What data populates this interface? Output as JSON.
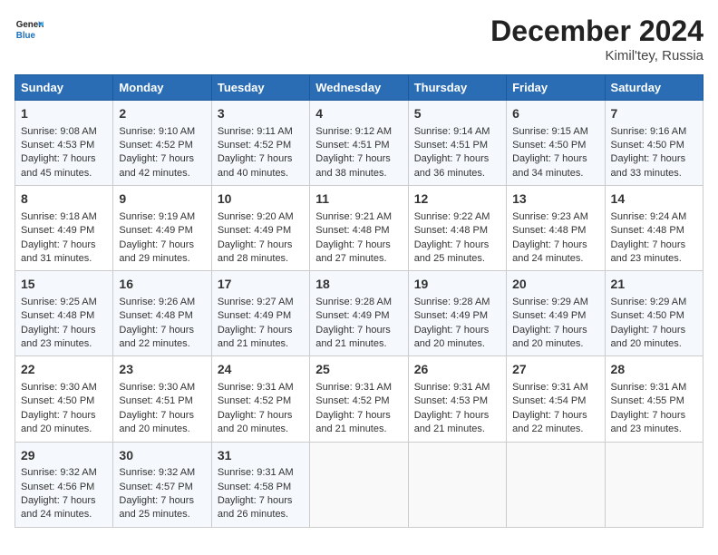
{
  "header": {
    "logo_line1": "General",
    "logo_line2": "Blue",
    "title": "December 2024",
    "subtitle": "Kimil'tey, Russia"
  },
  "weekdays": [
    "Sunday",
    "Monday",
    "Tuesday",
    "Wednesday",
    "Thursday",
    "Friday",
    "Saturday"
  ],
  "weeks": [
    [
      {
        "day": "1",
        "sun": "9:08 AM",
        "set": "4:53 PM",
        "hours": "7 hours and 45 minutes."
      },
      {
        "day": "2",
        "sun": "9:10 AM",
        "set": "4:52 PM",
        "hours": "7 hours and 42 minutes."
      },
      {
        "day": "3",
        "sun": "9:11 AM",
        "set": "4:52 PM",
        "hours": "7 hours and 40 minutes."
      },
      {
        "day": "4",
        "sun": "9:12 AM",
        "set": "4:51 PM",
        "hours": "7 hours and 38 minutes."
      },
      {
        "day": "5",
        "sun": "9:14 AM",
        "set": "4:51 PM",
        "hours": "7 hours and 36 minutes."
      },
      {
        "day": "6",
        "sun": "9:15 AM",
        "set": "4:50 PM",
        "hours": "7 hours and 34 minutes."
      },
      {
        "day": "7",
        "sun": "9:16 AM",
        "set": "4:50 PM",
        "hours": "7 hours and 33 minutes."
      }
    ],
    [
      {
        "day": "8",
        "sun": "9:18 AM",
        "set": "4:49 PM",
        "hours": "7 hours and 31 minutes."
      },
      {
        "day": "9",
        "sun": "9:19 AM",
        "set": "4:49 PM",
        "hours": "7 hours and 29 minutes."
      },
      {
        "day": "10",
        "sun": "9:20 AM",
        "set": "4:49 PM",
        "hours": "7 hours and 28 minutes."
      },
      {
        "day": "11",
        "sun": "9:21 AM",
        "set": "4:48 PM",
        "hours": "7 hours and 27 minutes."
      },
      {
        "day": "12",
        "sun": "9:22 AM",
        "set": "4:48 PM",
        "hours": "7 hours and 25 minutes."
      },
      {
        "day": "13",
        "sun": "9:23 AM",
        "set": "4:48 PM",
        "hours": "7 hours and 24 minutes."
      },
      {
        "day": "14",
        "sun": "9:24 AM",
        "set": "4:48 PM",
        "hours": "7 hours and 23 minutes."
      }
    ],
    [
      {
        "day": "15",
        "sun": "9:25 AM",
        "set": "4:48 PM",
        "hours": "7 hours and 23 minutes."
      },
      {
        "day": "16",
        "sun": "9:26 AM",
        "set": "4:48 PM",
        "hours": "7 hours and 22 minutes."
      },
      {
        "day": "17",
        "sun": "9:27 AM",
        "set": "4:49 PM",
        "hours": "7 hours and 21 minutes."
      },
      {
        "day": "18",
        "sun": "9:28 AM",
        "set": "4:49 PM",
        "hours": "7 hours and 21 minutes."
      },
      {
        "day": "19",
        "sun": "9:28 AM",
        "set": "4:49 PM",
        "hours": "7 hours and 20 minutes."
      },
      {
        "day": "20",
        "sun": "9:29 AM",
        "set": "4:49 PM",
        "hours": "7 hours and 20 minutes."
      },
      {
        "day": "21",
        "sun": "9:29 AM",
        "set": "4:50 PM",
        "hours": "7 hours and 20 minutes."
      }
    ],
    [
      {
        "day": "22",
        "sun": "9:30 AM",
        "set": "4:50 PM",
        "hours": "7 hours and 20 minutes."
      },
      {
        "day": "23",
        "sun": "9:30 AM",
        "set": "4:51 PM",
        "hours": "7 hours and 20 minutes."
      },
      {
        "day": "24",
        "sun": "9:31 AM",
        "set": "4:52 PM",
        "hours": "7 hours and 20 minutes."
      },
      {
        "day": "25",
        "sun": "9:31 AM",
        "set": "4:52 PM",
        "hours": "7 hours and 21 minutes."
      },
      {
        "day": "26",
        "sun": "9:31 AM",
        "set": "4:53 PM",
        "hours": "7 hours and 21 minutes."
      },
      {
        "day": "27",
        "sun": "9:31 AM",
        "set": "4:54 PM",
        "hours": "7 hours and 22 minutes."
      },
      {
        "day": "28",
        "sun": "9:31 AM",
        "set": "4:55 PM",
        "hours": "7 hours and 23 minutes."
      }
    ],
    [
      {
        "day": "29",
        "sun": "9:32 AM",
        "set": "4:56 PM",
        "hours": "7 hours and 24 minutes."
      },
      {
        "day": "30",
        "sun": "9:32 AM",
        "set": "4:57 PM",
        "hours": "7 hours and 25 minutes."
      },
      {
        "day": "31",
        "sun": "9:31 AM",
        "set": "4:58 PM",
        "hours": "7 hours and 26 minutes."
      },
      null,
      null,
      null,
      null
    ]
  ]
}
